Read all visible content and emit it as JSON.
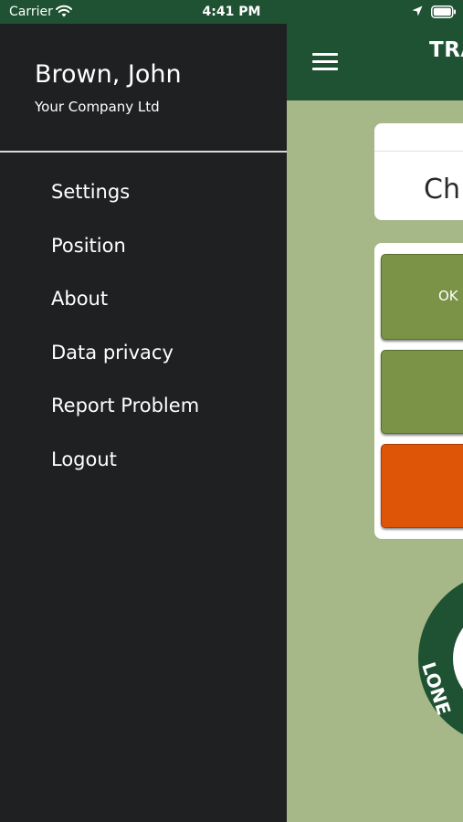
{
  "status_bar": {
    "carrier": "Carrier",
    "time": "4:41 PM",
    "icons": [
      "wifi-icon",
      "location-icon",
      "battery-icon"
    ]
  },
  "app": {
    "title": "TRA",
    "status_card_text": "Ch",
    "buttons": {
      "ok_label": "OK"
    },
    "logo_text": "LONE"
  },
  "drawer": {
    "user_name": "Brown, John",
    "company": "Your Company Ltd",
    "menu": [
      {
        "label": "Settings"
      },
      {
        "label": "Position"
      },
      {
        "label": "About"
      },
      {
        "label": "Data privacy"
      },
      {
        "label": "Report Problem"
      },
      {
        "label": "Logout"
      }
    ]
  },
  "colors": {
    "header_green": "#1f5233",
    "background_green": "#a7b888",
    "button_green": "#7a9347",
    "alert_orange": "#df5508",
    "drawer_dark": "#1f2022"
  }
}
